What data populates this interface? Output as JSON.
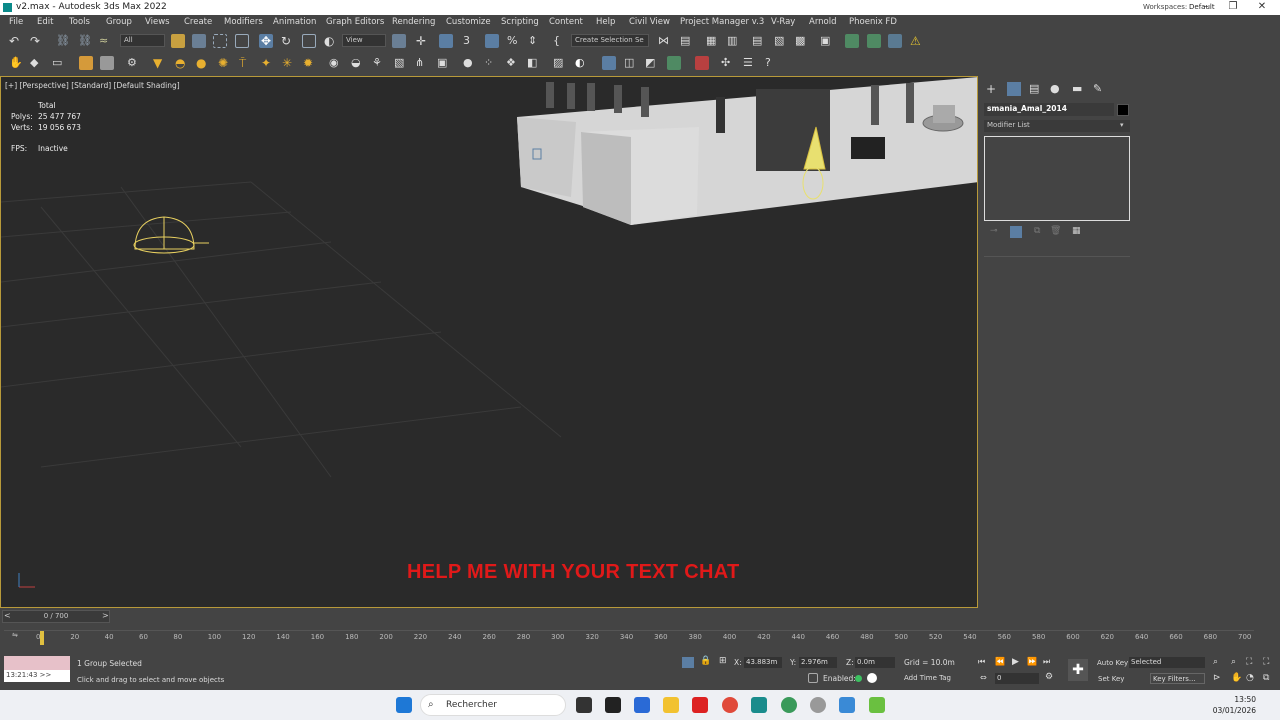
{
  "window": {
    "title": "v2.max - Autodesk 3ds Max 2022",
    "workspace_label": "Workspaces:",
    "workspace_value": "Default"
  },
  "menu": [
    "File",
    "Edit",
    "Tools",
    "Group",
    "Views",
    "Create",
    "Modifiers",
    "Animation",
    "Graph Editors",
    "Rendering",
    "Customize",
    "Scripting",
    "Content",
    "Help",
    "Civil View",
    "Project Manager v.3",
    "V-Ray",
    "Arnold",
    "Phoenix FD"
  ],
  "toolbar": {
    "filter_value": "All",
    "refcoord_value": "View",
    "selection_set_placeholder": "Create Selection Se"
  },
  "viewport": {
    "label": "[+] [Perspective] [Standard] [Default Shading]",
    "stats": {
      "total_label": "Total",
      "polys_label": "Polys:",
      "polys_value": "25 477 767",
      "verts_label": "Verts:",
      "verts_value": "19 056 673",
      "fps_label": "FPS:",
      "fps_value": "Inactive"
    },
    "overlay_text": "HELP ME WITH YOUR TEXT CHAT"
  },
  "command_panel": {
    "object_name": "smania_Amal_2014",
    "modifier_list": "Modifier List"
  },
  "timeline": {
    "slider": "0 / 700",
    "ticks": [
      "0",
      "20",
      "40",
      "60",
      "80",
      "100",
      "120",
      "140",
      "160",
      "180",
      "200",
      "220",
      "240",
      "260",
      "280",
      "300",
      "320",
      "340",
      "360",
      "380",
      "400",
      "420",
      "440",
      "460",
      "480",
      "500",
      "520",
      "540",
      "560",
      "580",
      "600",
      "620",
      "640",
      "660",
      "680",
      "700"
    ]
  },
  "status": {
    "selected": "1 Group Selected",
    "prompt": "Click and drag to select and move objects",
    "maxscript_time": "13:21:43 >>",
    "x_label": "X:",
    "x_value": "43.883m",
    "y_label": "Y:",
    "y_value": "2.976m",
    "z_label": "Z:",
    "z_value": "0.0m",
    "grid": "Grid = 10.0m",
    "enabled": "Enabled:",
    "add_time_tag": "Add Time Tag",
    "auto_key": "Auto Key",
    "set_key": "Set Key",
    "selected_dd": "Selected",
    "key_filters": "Key Filters...",
    "frame": "0"
  },
  "taskbar": {
    "search_placeholder": "Rechercher",
    "time": "13:50",
    "date": "03/01/2026"
  },
  "colors": {
    "accent": "#5b7ea3",
    "viewport_border": "#b89a3a",
    "overlay": "#e01919"
  }
}
